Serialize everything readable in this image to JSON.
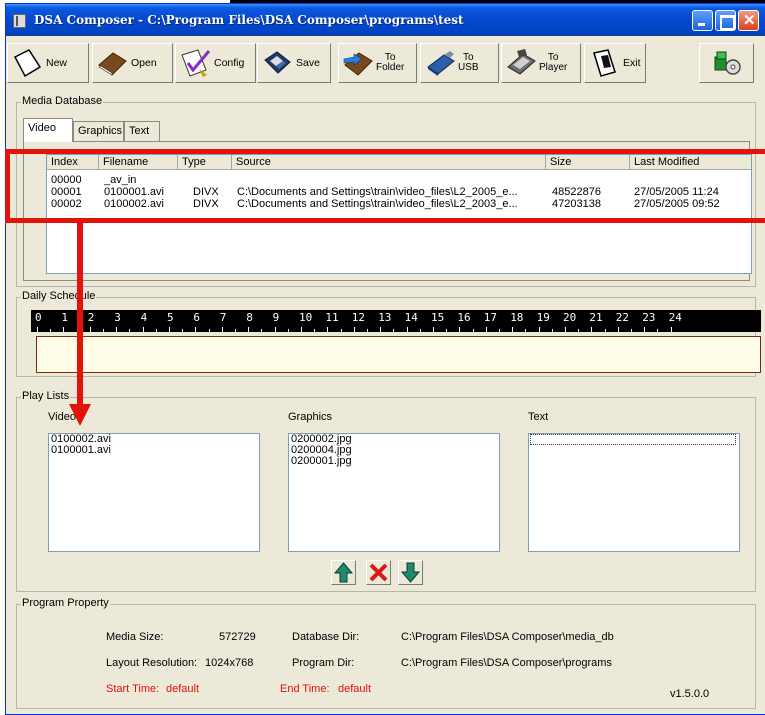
{
  "window": {
    "title": "DSA Composer - C:\\Program Files\\DSA Composer\\programs\\test"
  },
  "toolbar": {
    "new_label": "New",
    "open_label": "Open",
    "config_label": "Config",
    "save_label": "Save",
    "to_folder_line1": "To",
    "to_folder_line2": "Folder",
    "to_usb_line1": "To",
    "to_usb_line2": "USB",
    "to_player_line1": "To",
    "to_player_line2": "Player",
    "exit_label": "Exit"
  },
  "media_database": {
    "group_label": "Media Database",
    "tabs": [
      "Video",
      "Graphics",
      "Text"
    ],
    "active_tab": "Video",
    "columns": [
      "Index",
      "Filename",
      "Type",
      "Source",
      "Size",
      "Last Modified"
    ],
    "rows": [
      [
        "00000",
        "_av_in",
        "",
        "",
        "",
        ""
      ],
      [
        "00001",
        "0100001.avi",
        "DIVX",
        "C:\\Documents and Settings\\train\\video_files\\L2_2005_e...",
        "48522876",
        "27/05/2005 11:24"
      ],
      [
        "00002",
        "0100002.avi",
        "DIVX",
        "C:\\Documents and Settings\\train\\video_files\\L2_2003_e...",
        "47203138",
        "27/05/2005 09:52"
      ]
    ]
  },
  "daily_schedule": {
    "group_label": "Daily Schedule",
    "hours": [
      "0",
      "1",
      "2",
      "3",
      "4",
      "5",
      "6",
      "7",
      "8",
      "9",
      "10",
      "11",
      "12",
      "13",
      "14",
      "15",
      "16",
      "17",
      "18",
      "19",
      "20",
      "21",
      "22",
      "23",
      "24"
    ]
  },
  "play_lists": {
    "group_label": "Play Lists",
    "video_label": "Video",
    "graphics_label": "Graphics",
    "text_label": "Text",
    "video_items": [
      "0100002.avi",
      "0100001.avi"
    ],
    "graphics_items": [
      "0200002.jpg",
      "0200004.jpg",
      "0200001.jpg"
    ],
    "text_items": []
  },
  "program_property": {
    "group_label": "Program Property",
    "media_size_label": "Media Size:",
    "media_size_value": "572729",
    "layout_resolution_label": "Layout Resolution:",
    "layout_resolution_value": "1024x768",
    "start_time_label": "Start Time:",
    "start_time_value": "default",
    "database_dir_label": "Database Dir:",
    "database_dir_value": "C:\\Program Files\\DSA Composer\\media_db",
    "program_dir_label": "Program Dir:",
    "program_dir_value": "C:\\Program Files\\DSA Composer\\programs",
    "end_time_label": "End Time:",
    "end_time_value": "default",
    "version": "v1.5.0.0"
  },
  "colors": {
    "annotation_red": "#e3120b",
    "title_bar_blue": "#0548cf",
    "window_bg": "#ece9d8",
    "property_red_text": "#e01010"
  },
  "icons": {
    "new": "blank-page-icon",
    "open": "open-book-icon",
    "config": "checklist-icon",
    "save": "disk-save-icon",
    "to_folder": "folder-transfer-icon",
    "to_usb": "usb-drive-icon",
    "to_player": "media-player-icon",
    "exit": "exit-door-icon",
    "app_logo": "green-disc-app-icon",
    "move_up": "up-arrow-icon",
    "remove": "red-x-icon",
    "move_down": "down-arrow-icon"
  }
}
